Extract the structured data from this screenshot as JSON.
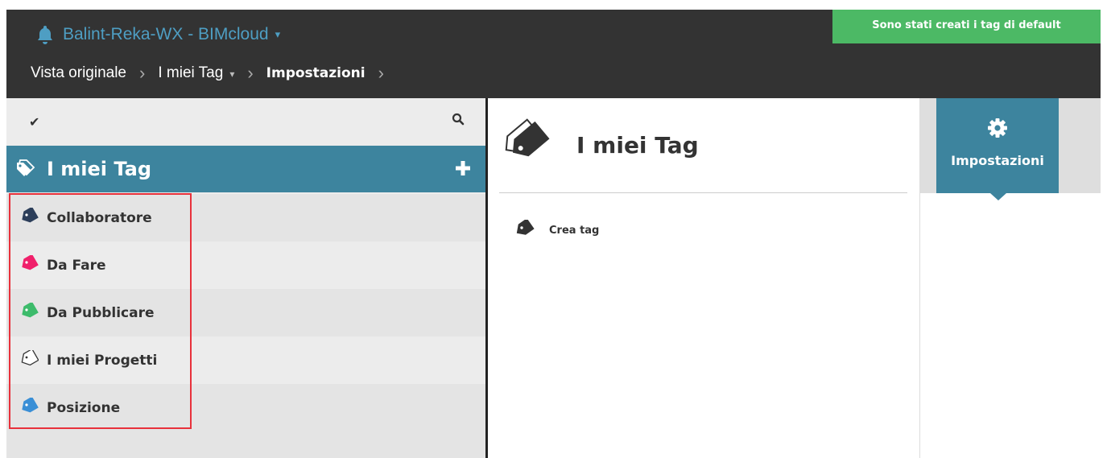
{
  "topbar": {
    "app_title": "Balint-Reka-WX - BIMcloud",
    "app_title_caret": "▾",
    "notification_icon": "bell-icon"
  },
  "breadcrumb": [
    {
      "label": "Vista originale"
    },
    {
      "label": "I miei Tag",
      "caret": "▾"
    },
    {
      "label": "Impostazioni"
    }
  ],
  "breadcrumb_separator": "›",
  "toast": {
    "message": "Sono stati creati i tag di default",
    "color": "#4cb965"
  },
  "left_panel": {
    "toolbar": {
      "check_icon": "✔",
      "search_icon": "search-icon"
    },
    "header": {
      "title": "I miei Tag",
      "icon": "tags-icon",
      "add_icon": "plus-icon"
    },
    "tags": [
      {
        "label": "Collaboratore",
        "color": "#2c3e5a",
        "outline": false
      },
      {
        "label": "Da Fare",
        "color": "#f0206b",
        "outline": false
      },
      {
        "label": "Da Pubblicare",
        "color": "#3dbb6b",
        "outline": false
      },
      {
        "label": "I miei Progetti",
        "color": "#ffffff",
        "outline": true
      },
      {
        "label": "Posizione",
        "color": "#3a8fd6",
        "outline": false
      }
    ],
    "highlight_color": "#e8313b"
  },
  "middle_panel": {
    "title": "I miei Tag",
    "title_icon": "tags-icon",
    "create_tag_label": "Crea tag",
    "create_tag_icon": "tag-icon"
  },
  "right_panel": {
    "tab_label": "Impostazioni",
    "tab_icon": "gear-icon"
  },
  "colors": {
    "accent": "#3d849e",
    "topbar": "#333333",
    "title_link": "#4e9ec3"
  }
}
